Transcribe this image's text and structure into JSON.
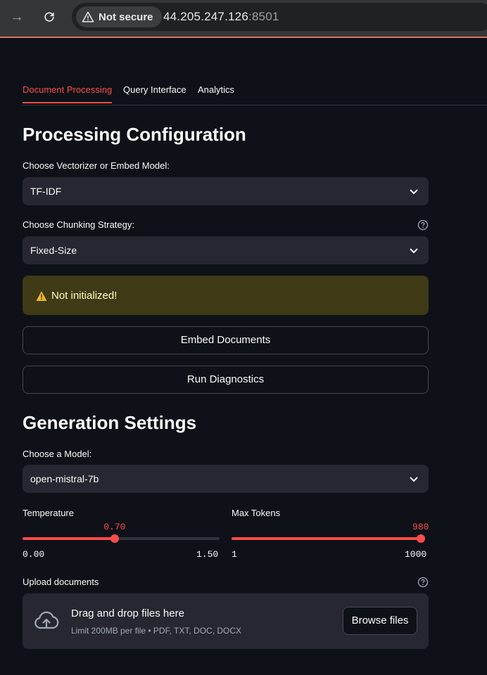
{
  "browser": {
    "security_label": "Not secure",
    "url_host": "44.205.247.126",
    "url_port": ":8501"
  },
  "tabs": [
    {
      "label": "Document Processing",
      "active": true
    },
    {
      "label": "Query Interface",
      "active": false
    },
    {
      "label": "Analytics",
      "active": false
    }
  ],
  "processing": {
    "heading": "Processing Configuration",
    "vectorizer_label": "Choose Vectorizer or Embed Model:",
    "vectorizer_value": "TF-IDF",
    "chunking_label": "Choose Chunking Strategy:",
    "chunking_value": "Fixed-Size",
    "warning": "Not initialized!",
    "embed_button": "Embed Documents",
    "diagnostics_button": "Run Diagnostics"
  },
  "generation": {
    "heading": "Generation Settings",
    "model_label": "Choose a Model:",
    "model_value": "open-mistral-7b",
    "temperature": {
      "label": "Temperature",
      "value": "0.70",
      "min": "0.00",
      "max": "1.50",
      "fraction": 0.467
    },
    "max_tokens": {
      "label": "Max Tokens",
      "value": "980",
      "min": "1",
      "max": "1000",
      "fraction": 0.98
    }
  },
  "upload": {
    "label": "Upload documents",
    "drop_title": "Drag and drop files here",
    "drop_subtitle": "Limit 200MB per file • PDF, TXT, DOC, DOCX",
    "browse_button": "Browse files"
  },
  "colors": {
    "accent": "#ff4b4b",
    "background": "#0e1117",
    "warning_bg": "#3e3b16"
  }
}
